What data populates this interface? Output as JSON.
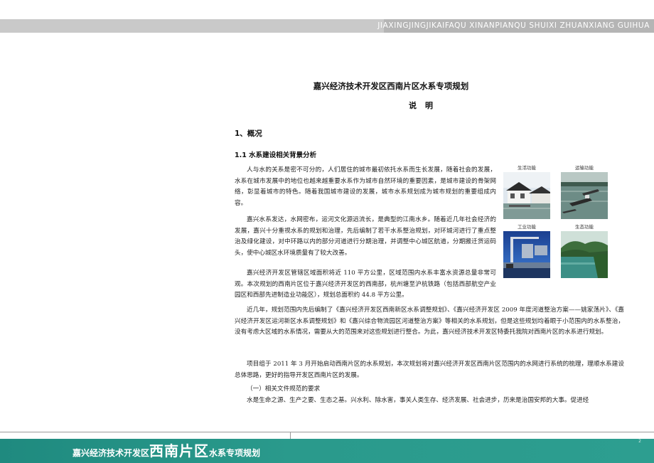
{
  "header": {
    "banner_text": "JIAXINGJINGJIKAIFAQU XINANPIANQU SHUIXI ZHUANXIANG GUIHUA"
  },
  "document": {
    "title": "嘉兴经济技术开发区西南片区水系专项规划",
    "subtitle": "说明",
    "section_1": "1、概况",
    "section_1_1": "1.1 水系建设相关背景分析",
    "paragraphs": [
      "人与水的关系是密不可分的，人们居住的城市最初依托水系而生长发展，随着社会的发展，水系在城市发展中的地位也越来越重要水系作为城市自然环境的重要因素，是城市建设的骨架网络，彰显着城市的特色。随着我国城市建设的发展，城市水系规划成为城市规划的重要组成内容。",
      "嘉兴水系发达，水网密布，运河文化源远流长，是典型的江南水乡。随着近几年社会经济的发展，嘉兴十分重视水系的规划和治理，先后编制了若干水系整治规划，对环城河进行了重点整治及绿化建设，对中环路以内的部分河道进行分期治理，并调整中心城区航道，分期搬迁货运码头，使中心城区水环境质量有了较大改善。",
      "嘉兴经济开发区管辖区域面积将近 110 平方公里，区域范围内水系丰富水资源总量非常可观。本次规划的西南片区位于嘉兴经济开发区的西南部，杭州塘至沪杭铁路（包括西部航空产业园区和西部先进制造业功能区），规划总面积约 44.8 平方公里。",
      "近几年，规划范围内先后编制了《嘉兴经济开发区西南新区水系调整规划》、《嘉兴经济开发区 2009 年度河道整治方案——姚家荡片》、《嘉兴经济开发区运河新区水系调整规划》和《嘉兴综合物流园区河道整治方案》等相关的水系规划，但是这些规划均着眼于小范围内的水系整治，没有考虑大区域的水系情况，需要从大的范围来对这些规划进行整合。为此，嘉兴经济技术开发区特委托我院对西南片区的水系进行规划。",
      "项目组于 2011 年 3 月开始启动西南片区的水系规划，本次规划将对嘉兴经济开发区西南片区范围内的水网进行系统的梳理，理顺水系建设总体思路，更好的指导开发区西南片区的发展。",
      "（一）相关文件规范的要求",
      "水是生命之源、生产之要、生态之基。兴水利、除水害，事关人类生存、经济发展、社会进步，历来是治国安邦的大事。促进经"
    ]
  },
  "photos": [
    {
      "label": "生活功能",
      "icon": "canal-town-photo"
    },
    {
      "label": "运输功能",
      "icon": "cargo-boat-photo"
    },
    {
      "label": "工业功能",
      "icon": "industrial-crane-photo"
    },
    {
      "label": "生态功能",
      "icon": "lake-landscape-photo"
    }
  ],
  "footer": {
    "title_part1": "嘉兴经济技术开发区",
    "title_part2": "西南片区",
    "title_part3": "水系专项规划",
    "page_number": "2"
  }
}
